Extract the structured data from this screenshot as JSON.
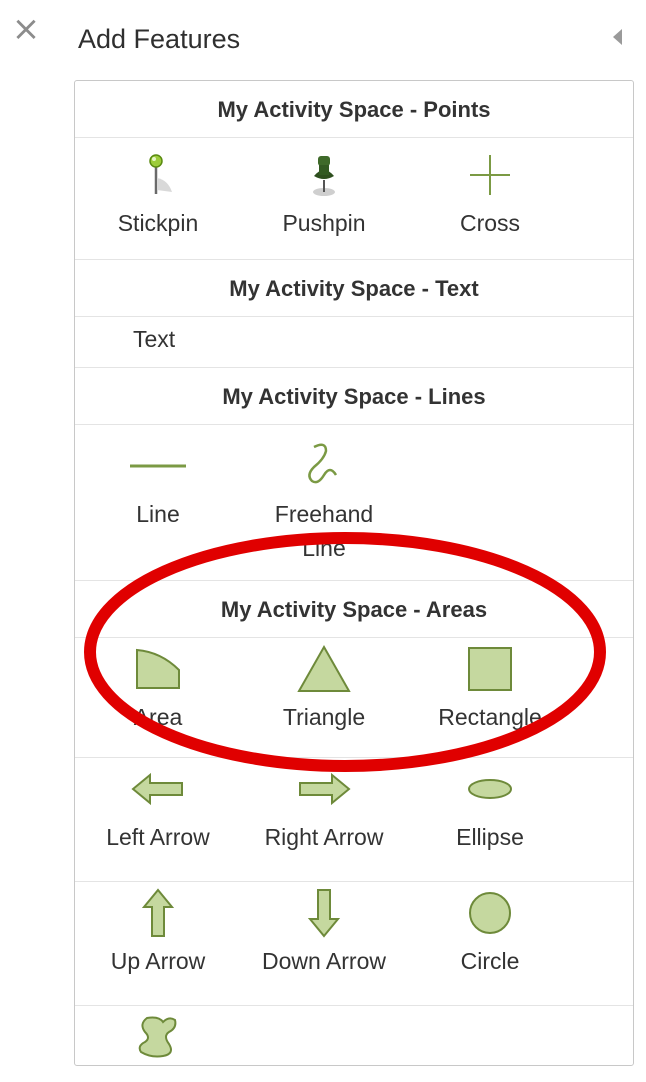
{
  "header": {
    "title": "Add Features",
    "close_icon": "close-icon",
    "collapse_icon": "collapse-left-icon"
  },
  "sections": {
    "points": {
      "title": "My Activity Space - Points",
      "items": [
        {
          "label": "Stickpin",
          "icon": "stickpin-icon"
        },
        {
          "label": "Pushpin",
          "icon": "pushpin-icon"
        },
        {
          "label": "Cross",
          "icon": "cross-icon"
        }
      ]
    },
    "text": {
      "title": "My Activity Space - Text",
      "items": [
        {
          "label": "Text"
        }
      ]
    },
    "lines": {
      "title": "My Activity Space - Lines",
      "items": [
        {
          "label": "Line",
          "icon": "line-icon"
        },
        {
          "label": "Freehand Line",
          "icon": "freehand-line-icon"
        }
      ]
    },
    "areas": {
      "title": "My Activity Space - Areas",
      "items": [
        {
          "label": "Area",
          "icon": "area-icon"
        },
        {
          "label": "Triangle",
          "icon": "triangle-icon"
        },
        {
          "label": "Rectangle",
          "icon": "rectangle-icon"
        },
        {
          "label": "Left Arrow",
          "icon": "left-arrow-icon"
        },
        {
          "label": "Right Arrow",
          "icon": "right-arrow-icon"
        },
        {
          "label": "Ellipse",
          "icon": "ellipse-icon"
        },
        {
          "label": "Up Arrow",
          "icon": "up-arrow-icon"
        },
        {
          "label": "Down Arrow",
          "icon": "down-arrow-icon"
        },
        {
          "label": "Circle",
          "icon": "circle-icon"
        },
        {
          "label": "",
          "icon": "freehand-area-icon"
        }
      ]
    }
  },
  "colors": {
    "shape_fill": "#c5d89f",
    "shape_stroke": "#6e8a3a",
    "highlight": "#e00000"
  }
}
